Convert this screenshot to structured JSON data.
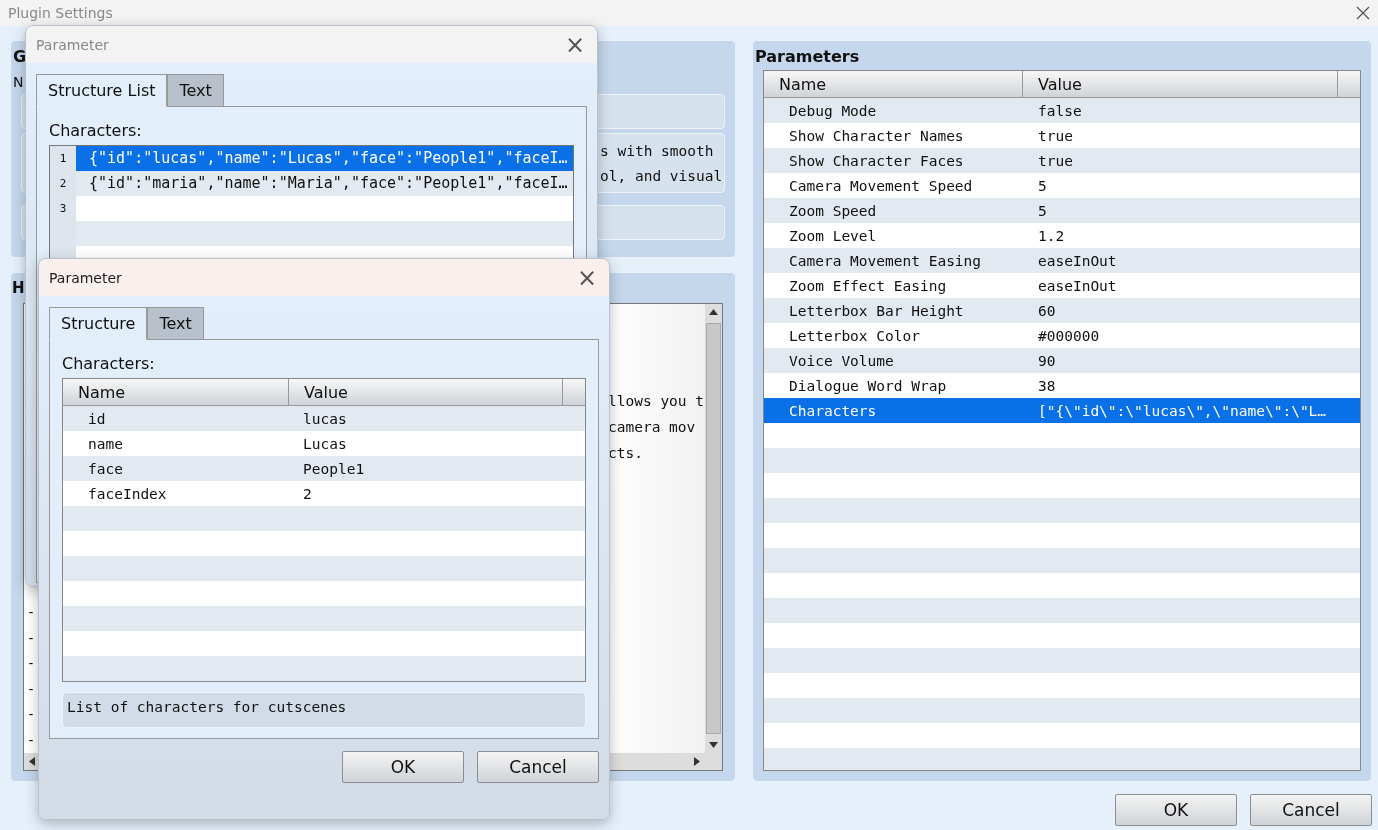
{
  "window": {
    "title": "Plugin Settings"
  },
  "general_panel": {
    "heading": "G",
    "label": "N",
    "description_lines": [
      "s with smooth",
      "ol, and visual"
    ]
  },
  "help_panel": {
    "heading": "H",
    "text_lines": [
      "llows you t",
      "camera mov",
      "cts."
    ],
    "gutter_marks": [
      "-",
      "-",
      "-",
      "-",
      "-",
      "-"
    ]
  },
  "parameters_panel": {
    "heading": "Parameters",
    "columns": [
      "Name",
      "Value"
    ],
    "rows": [
      {
        "name": "Debug Mode",
        "value": "false",
        "selected": false
      },
      {
        "name": "Show Character Names",
        "value": "true",
        "selected": false
      },
      {
        "name": "Show Character Faces",
        "value": "true",
        "selected": false
      },
      {
        "name": "Camera Movement Speed",
        "value": "5",
        "selected": false
      },
      {
        "name": "Zoom Speed",
        "value": "5",
        "selected": false
      },
      {
        "name": "Zoom Level",
        "value": "1.2",
        "selected": false
      },
      {
        "name": "Camera Movement Easing",
        "value": "easeInOut",
        "selected": false
      },
      {
        "name": "Zoom Effect Easing",
        "value": "easeInOut",
        "selected": false
      },
      {
        "name": "Letterbox Bar Height",
        "value": "60",
        "selected": false
      },
      {
        "name": "Letterbox Color",
        "value": "#000000",
        "selected": false
      },
      {
        "name": "Voice Volume",
        "value": "90",
        "selected": false
      },
      {
        "name": "Dialogue Word Wrap",
        "value": "38",
        "selected": false
      },
      {
        "name": "Characters",
        "value": "[\"{\\\"id\\\":\\\"lucas\\\",\\\"name\\\":\\\"L…",
        "selected": true
      }
    ]
  },
  "buttons": [
    "OK",
    "Cancel"
  ],
  "dialogs": [
    {
      "title": "Parameter",
      "close": "×",
      "kind": "list",
      "tabs": [
        {
          "label": "Structure List",
          "selected": true
        },
        {
          "label": "Text",
          "selected": false
        }
      ],
      "field_label": "Characters:",
      "list_rows": [
        {
          "number": "1",
          "text": "{\"id\":\"lucas\",\"name\":\"Lucas\",\"face\":\"People1\",\"faceI…",
          "selected": true
        },
        {
          "number": "2",
          "text": "{\"id\":\"maria\",\"name\":\"Maria\",\"face\":\"People1\",\"faceI…",
          "selected": false
        },
        {
          "number": "3",
          "selected": false
        }
      ]
    },
    {
      "title": "Parameter",
      "close": "×",
      "kind": "table",
      "tabs": [
        {
          "label": "Structure",
          "selected": true
        },
        {
          "label": "Text",
          "selected": false
        }
      ],
      "field_label": "Characters:",
      "columns": [
        "Name",
        "Value"
      ],
      "rows": [
        {
          "name": "id",
          "value": "lucas"
        },
        {
          "name": "name",
          "value": "Lucas"
        },
        {
          "name": "face",
          "value": "People1"
        },
        {
          "name": "faceIndex",
          "value": "2"
        }
      ],
      "description": "List of characters for cutscenes",
      "buttons": [
        "OK",
        "Cancel"
      ]
    }
  ]
}
